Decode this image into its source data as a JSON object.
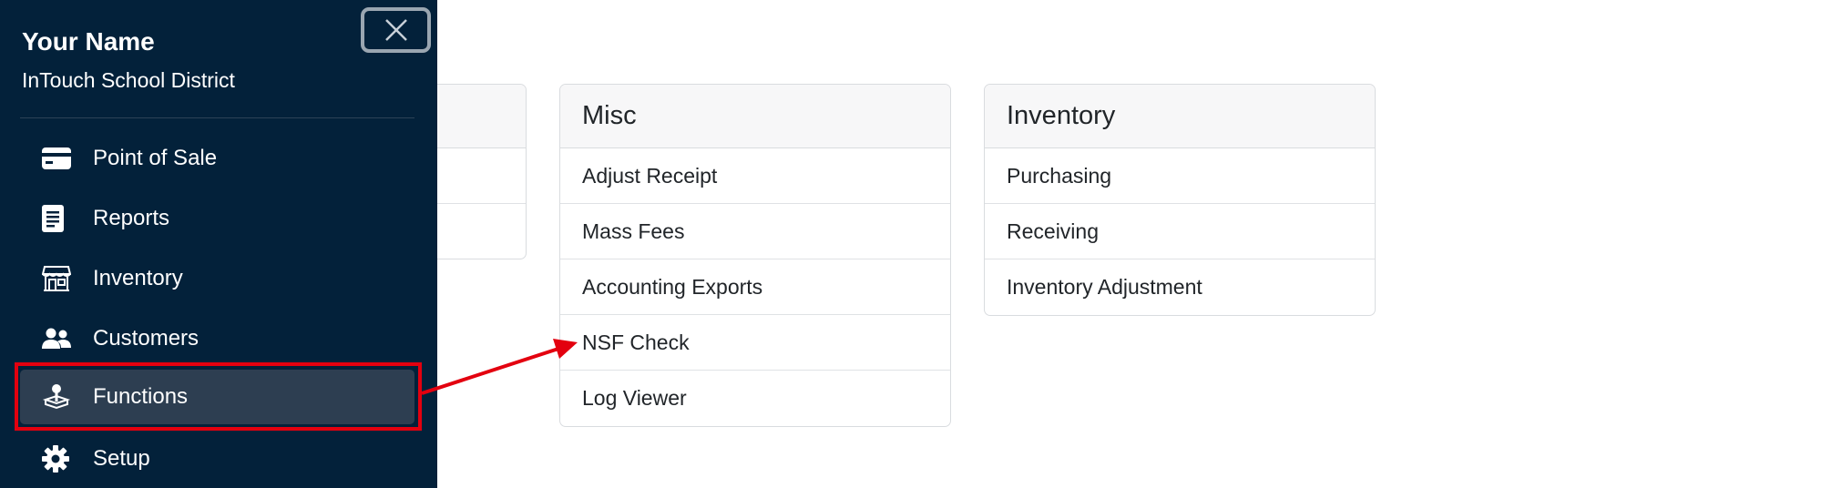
{
  "sidebar": {
    "user_name": "Your Name",
    "organization": "InTouch School District",
    "nav_items": [
      {
        "label": "Point of Sale",
        "icon": "credit-card-icon"
      },
      {
        "label": "Reports",
        "icon": "document-icon"
      },
      {
        "label": "Inventory",
        "icon": "store-icon"
      },
      {
        "label": "Customers",
        "icon": "users-icon"
      },
      {
        "label": "Functions",
        "icon": "joystick-icon",
        "active": true
      },
      {
        "label": "Setup",
        "icon": "gear-icon"
      }
    ]
  },
  "cards": {
    "misc": {
      "title": "Misc",
      "items": [
        "Adjust Receipt",
        "Mass Fees",
        "Accounting Exports",
        "NSF Check",
        "Log Viewer"
      ]
    },
    "inventory": {
      "title": "Inventory",
      "items": [
        "Purchasing",
        "Receiving",
        "Inventory Adjustment"
      ]
    }
  },
  "colors": {
    "sidebar_bg": "#03213a",
    "active_bg": "#2d3e51",
    "annotation_red": "#e3000f"
  }
}
